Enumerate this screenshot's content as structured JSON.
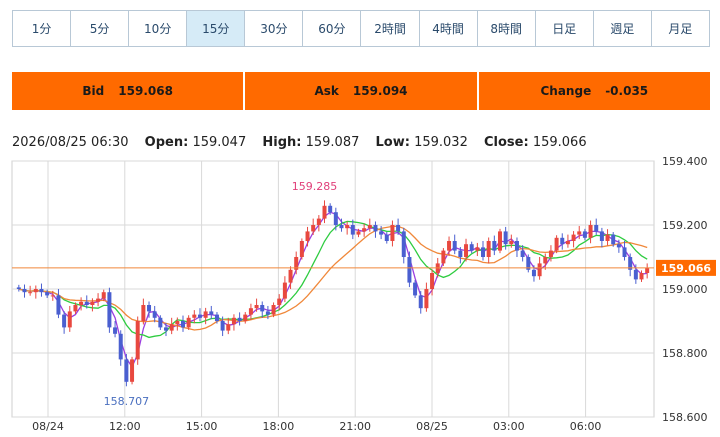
{
  "timeframes": [
    {
      "label": "1分",
      "active": false
    },
    {
      "label": "5分",
      "active": false
    },
    {
      "label": "10分",
      "active": false
    },
    {
      "label": "15分",
      "active": true
    },
    {
      "label": "30分",
      "active": false
    },
    {
      "label": "60分",
      "active": false
    },
    {
      "label": "2時間",
      "active": false
    },
    {
      "label": "4時間",
      "active": false
    },
    {
      "label": "8時間",
      "active": false
    },
    {
      "label": "日足",
      "active": false
    },
    {
      "label": "週足",
      "active": false
    },
    {
      "label": "月足",
      "active": false
    }
  ],
  "quotes": {
    "bid_label": "Bid",
    "bid_value": "159.068",
    "ask_label": "Ask",
    "ask_value": "159.094",
    "change_label": "Change",
    "change_value": "-0.035"
  },
  "ohlc": {
    "datetime": "2026/08/25 06:30",
    "open_label": "Open:",
    "open": "159.047",
    "high_label": "High:",
    "high": "159.087",
    "low_label": "Low:",
    "low": "159.032",
    "close_label": "Close:",
    "close": "159.066"
  },
  "colors": {
    "up": "#e8483f",
    "down": "#4a5fd0",
    "ma_short": "#9b3ee0",
    "ma_mid": "#2ecc40",
    "ma_long": "#f0883a",
    "price_line": "#f0883a",
    "price_badge": "#ff6a00",
    "grid": "#d9d9d9",
    "high_label": "#e0407a",
    "low_label": "#4a6fbf"
  },
  "chart_data": {
    "type": "candlestick",
    "ylim": [
      158.6,
      159.4
    ],
    "yticks": [
      "159.400",
      "159.200",
      "159.000",
      "158.800",
      "158.600"
    ],
    "xticks": [
      "08/24",
      "12:00",
      "15:00",
      "18:00",
      "21:00",
      "08/25",
      "03:00",
      "06:00"
    ],
    "current_price": "159.066",
    "high_annotation": "159.285",
    "low_annotation": "158.707",
    "closes": [
      159.0,
      158.99,
      158.99,
      159.0,
      158.99,
      158.98,
      158.98,
      158.92,
      158.88,
      158.93,
      158.95,
      158.96,
      158.95,
      158.96,
      158.97,
      158.99,
      158.88,
      158.86,
      158.78,
      158.71,
      158.78,
      158.9,
      158.95,
      158.93,
      158.91,
      158.88,
      158.87,
      158.89,
      158.9,
      158.88,
      158.91,
      158.92,
      158.91,
      158.93,
      158.92,
      158.9,
      158.87,
      158.89,
      158.91,
      158.9,
      158.92,
      158.94,
      158.95,
      158.93,
      158.92,
      158.95,
      158.97,
      159.02,
      159.06,
      159.1,
      159.15,
      159.18,
      159.2,
      159.22,
      159.26,
      159.24,
      159.2,
      159.19,
      159.2,
      159.17,
      159.18,
      159.19,
      159.2,
      159.18,
      159.17,
      159.15,
      159.2,
      159.18,
      159.1,
      159.02,
      158.98,
      158.94,
      159.0,
      159.05,
      159.08,
      159.12,
      159.15,
      159.12,
      159.1,
      159.14,
      159.12,
      159.13,
      159.1,
      159.15,
      159.12,
      159.18,
      159.14,
      159.15,
      159.12,
      159.1,
      159.06,
      159.04,
      159.08,
      159.1,
      159.12,
      159.16,
      159.14,
      159.15,
      159.17,
      159.18,
      159.16,
      159.2,
      159.18,
      159.15,
      159.17,
      159.14,
      159.13,
      159.1,
      159.06,
      159.03,
      159.05,
      159.066
    ]
  }
}
